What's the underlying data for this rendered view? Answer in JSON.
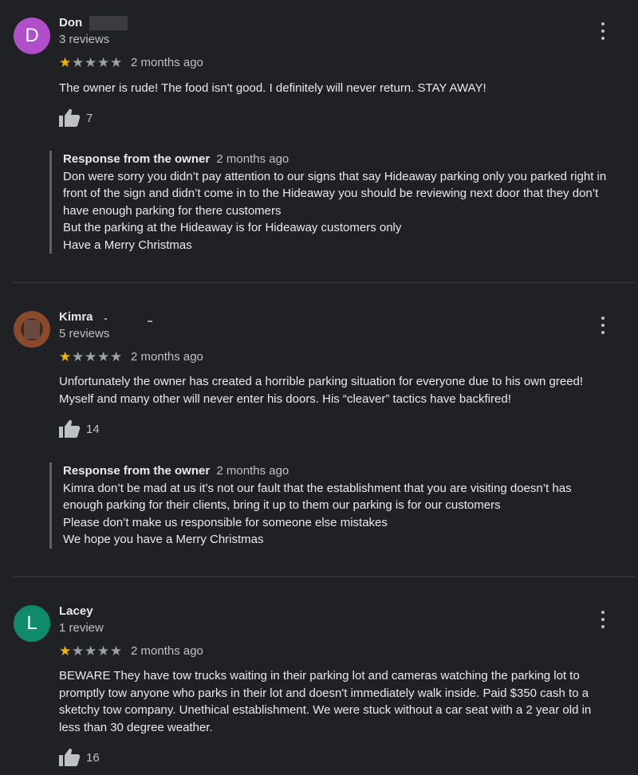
{
  "reviews": [
    {
      "initial": "D",
      "avatar_color": "#b04fc9",
      "name": "Don",
      "reviews_count": "3 reviews",
      "rating": 1,
      "date": "2 months ago",
      "text": "The owner is rude! The food isn't good. I definitely will never return. STAY AWAY!",
      "likes": "7",
      "response_label": "Response from the owner",
      "response_date": "2 months ago",
      "response_lines": [
        "Don were sorry you didn’t pay attention to our signs that say Hideaway parking only you parked right in",
        "front of the sign and didn’t come in to the Hideaway you should be reviewing next door that they don’t",
        "have enough parking for there customers",
        "But the parking at the Hideaway is for Hideaway customers only",
        "Have a Merry Christmas"
      ]
    },
    {
      "initial": "",
      "avatar_color": "#8a4b2c",
      "name": "Kimra",
      "reviews_count": "5 reviews",
      "rating": 1,
      "date": "2 months ago",
      "text_lines": [
        "Unfortunately the owner has created a horrible parking situation for everyone due to his own greed!",
        "Myself and many other will never enter his doors. His “cleaver” tactics have backfired!"
      ],
      "likes": "14",
      "response_label": "Response from the owner",
      "response_date": "2 months ago",
      "response_lines": [
        "Kimra don’t be mad at us it’s not our fault that the establishment that you are visiting doesn’t has",
        "enough parking for their clients, bring it up to them our parking is for our customers",
        "Please don’t make us responsible for someone else mistakes",
        "We hope you have a Merry Christmas"
      ]
    },
    {
      "initial": "L",
      "avatar_color": "#0f8a6b",
      "name": "Lacey",
      "reviews_count": "1 review",
      "rating": 1,
      "date": "2 months ago",
      "text_lines": [
        "BEWARE They have tow trucks waiting in their parking lot and cameras watching the parking lot to",
        "promptly tow anyone who parks in their lot and doesn't immediately walk inside. Paid $350 cash to a",
        "sketchy tow company. Unethical establishment. We were stuck without a car seat with a 2 year old in",
        "less than 30 degree weather."
      ],
      "likes": "16"
    }
  ]
}
